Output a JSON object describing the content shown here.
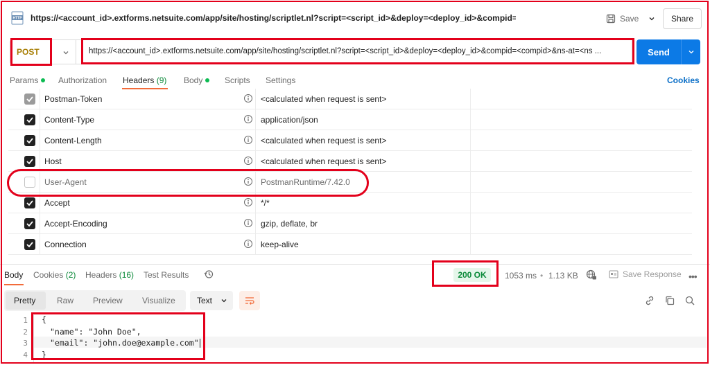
{
  "titlebar": {
    "title": "https://<account_id>.extforms.netsuite.com/app/site/hosting/scriptlet.nl?script=<script_id>&deploy=<deploy_id>&compid=<c",
    "save_label": "Save",
    "share_label": "Share",
    "icon": "http-icon"
  },
  "request": {
    "method": "POST",
    "url": "https://<account_id>.extforms.netsuite.com/app/site/hosting/scriptlet.nl?script=<script_id>&deploy=<deploy_id>&compid=<compid>&ns-at=<ns ...",
    "send_label": "Send"
  },
  "request_tabs": [
    {
      "label": "Params",
      "dot": true
    },
    {
      "label": "Authorization"
    },
    {
      "label": "Headers",
      "count": "(9)",
      "active": true
    },
    {
      "label": "Body",
      "dot": true
    },
    {
      "label": "Scripts"
    },
    {
      "label": "Settings"
    }
  ],
  "cookies_label": "Cookies",
  "headers": [
    {
      "key": "Postman-Token",
      "value": "<calculated when request is sent>",
      "state": "locked"
    },
    {
      "key": "Content-Type",
      "value": "application/json",
      "state": "checked"
    },
    {
      "key": "Content-Length",
      "value": "<calculated when request is sent>",
      "state": "checked"
    },
    {
      "key": "Host",
      "value": "<calculated when request is sent>",
      "state": "checked"
    },
    {
      "key": "User-Agent",
      "value": "PostmanRuntime/7.42.0",
      "state": "unchecked"
    },
    {
      "key": "Accept",
      "value": "*/*",
      "state": "checked"
    },
    {
      "key": "Accept-Encoding",
      "value": "gzip, deflate, br",
      "state": "checked"
    },
    {
      "key": "Connection",
      "value": "keep-alive",
      "state": "checked"
    }
  ],
  "response": {
    "tabs": [
      {
        "label": "Body",
        "active": true
      },
      {
        "label": "Cookies",
        "count": "(2)"
      },
      {
        "label": "Headers",
        "count": "(16)"
      },
      {
        "label": "Test Results"
      }
    ],
    "status": "200 OK",
    "time": "1053 ms",
    "size": "1.13 KB",
    "save_response_label": "Save Response",
    "view_tabs": [
      "Pretty",
      "Raw",
      "Preview",
      "Visualize"
    ],
    "format": "Text",
    "line_numbers": [
      "1",
      "2",
      "3",
      "4"
    ],
    "code_lines": [
      "\"name\": \"John Doe\",",
      "\"email\": \"john.doe@example.com\""
    ],
    "open_brace": "{",
    "close_brace": "}"
  },
  "colors": {
    "accent": "#0c7ae6",
    "status_ok": "#0c8a3a",
    "tab_underline": "#f26b3a",
    "annotation": "#e3001b",
    "method_post": "#a67c00"
  }
}
